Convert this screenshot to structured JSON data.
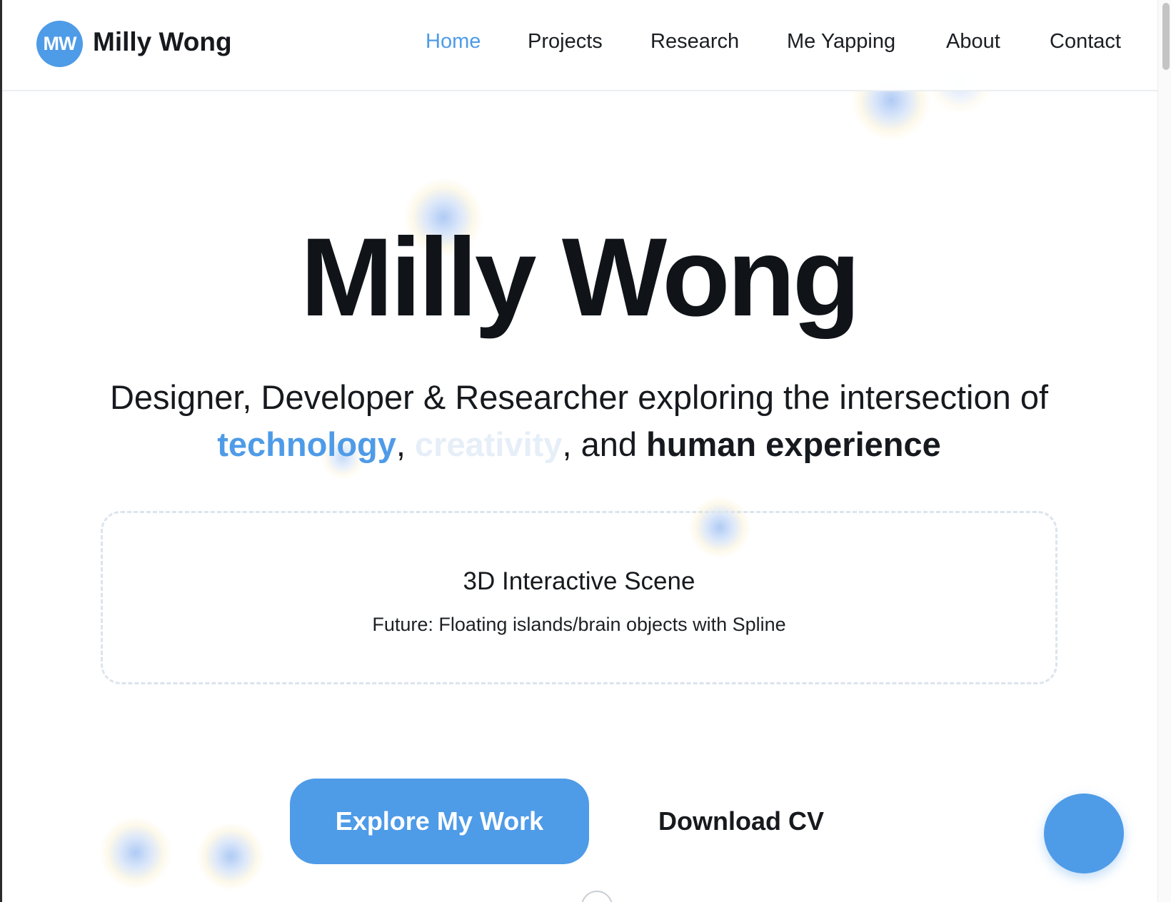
{
  "header": {
    "logo_initials": "MW",
    "logo_name": "Milly Wong",
    "nav": [
      {
        "label": "Home",
        "active": true
      },
      {
        "label": "Projects",
        "active": false
      },
      {
        "label": "Research",
        "active": false
      },
      {
        "label": "Me Yapping",
        "active": false
      },
      {
        "label": "About",
        "active": false
      },
      {
        "label": "Contact",
        "active": false
      }
    ]
  },
  "hero": {
    "title": "Milly Wong",
    "subtitle_line1": "Designer, Developer & Researcher exploring the intersection of",
    "highlight_technology": "technology",
    "comma1": ", ",
    "highlight_creativity": "creativity",
    "comma2": ", and ",
    "highlight_human": "human experience"
  },
  "scene": {
    "title": "3D Interactive Scene",
    "description": "Future: Floating islands/brain objects with Spline"
  },
  "actions": {
    "primary_label": "Explore My Work",
    "secondary_label": "Download CV"
  },
  "colors": {
    "accent": "#4e9be8",
    "text": "#16191d",
    "muted_highlight": "#e6eef8"
  },
  "icons": {
    "fab": "floating-action-circle",
    "scroll": "scroll-down-indicator-icon"
  }
}
